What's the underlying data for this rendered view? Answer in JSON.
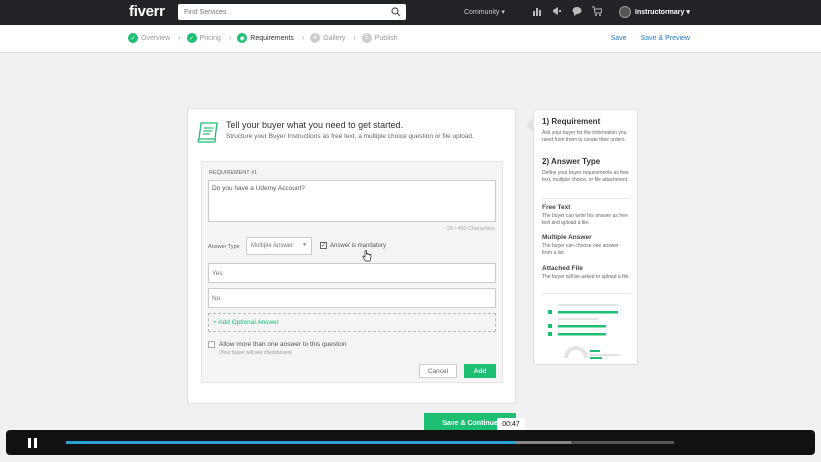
{
  "topbar": {
    "logo": "fiverr",
    "search_placeholder": "Find Services",
    "community_label": "Community ▾",
    "username": "Instructormary ▾"
  },
  "steps": [
    {
      "label": "Overview",
      "state": "done"
    },
    {
      "label": "Pricing",
      "state": "done"
    },
    {
      "label": "Requirements",
      "state": "active"
    },
    {
      "label": "Gallery",
      "state": "todo",
      "num": "4"
    },
    {
      "label": "Publish",
      "state": "todo",
      "num": "5"
    }
  ],
  "stepbar": {
    "save_label": "Save",
    "save_preview_label": "Save & Preview"
  },
  "card": {
    "title": "Tell your buyer what you need to get started.",
    "subtitle": "Structure your Buyer Instructions as free text, a multiple choice question or file upload.",
    "requirement_label": "REQUIREMENT #1",
    "question_text": "Do you have a Udemy Account?",
    "char_count": "28 / 450 Characters",
    "answer_type_label": "Answer Type",
    "answer_type_value": "Multiple Answer",
    "mandatory_label": "Answer is mandatory",
    "answers": [
      "Yes",
      "No"
    ],
    "add_optional_label": "+ Add Optional Answer",
    "allow_multiple_label": "Allow more than one answer to this question",
    "allow_multiple_sub": "(Your buyer will see checkboxes)",
    "cancel_label": "Cancel",
    "add_label": "Add"
  },
  "help": {
    "req_title": "1) Requirement",
    "req_text": "Ask your buyer for the information you need from them to create their orders.",
    "ans_title": "2) Answer Type",
    "ans_text": "Define your buyer requirements as free text, multiple choice, or file attachment.",
    "free_title": "Free Text",
    "free_text": "The buyer can write his answer as free text and upload a file.",
    "multi_title": "Multiple Answer",
    "multi_text": "The buyer can choose one answer from a list.",
    "file_title": "Attached File",
    "file_text": "The buyer will be asked to upload a file."
  },
  "save_continue_label": "Save & Continue",
  "video": {
    "time": "00:47",
    "progress": 0.74,
    "buffered": 0.83
  },
  "colors": {
    "green": "#1dbf73",
    "link_blue": "#2a7ec4",
    "progress_blue": "#2a9fd6"
  }
}
